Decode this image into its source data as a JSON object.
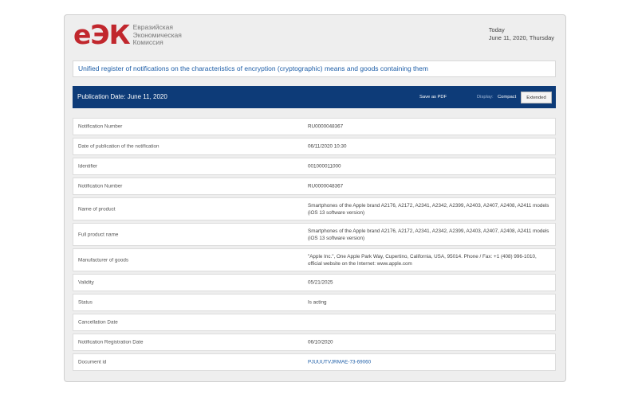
{
  "logo": {
    "mark": "еЭК",
    "line1": "Евразийская",
    "line2": "Экономическая",
    "line3": "Комиссия"
  },
  "today": {
    "label": "Today",
    "date": "June 11, 2020, Thursday"
  },
  "register_title": "Unified register of notifications on the characteristics of encryption (cryptographic) means and goods containing them",
  "publication_bar": {
    "date": "Publication Date: June 11, 2020",
    "save_pdf": "Save as PDF",
    "display_label": "Display:",
    "compact": "Compact",
    "extended": "Extended",
    "bg_color": "#0d3b78"
  },
  "rows": [
    {
      "label": "Notification Number",
      "value": "RU0000048367"
    },
    {
      "label": "Date of publication of the notification",
      "value": "06/11/2020 10:30"
    },
    {
      "label": "Identifier",
      "value": "001000011000"
    },
    {
      "label": "Notification Number",
      "value": "RU0000048367"
    },
    {
      "label": "Name of product",
      "value": "Smartphones of the Apple brand A2176, A2172, A2341, A2342, A2399, A2403, A2407, A2408, A2411 models (iOS 13 software version)"
    },
    {
      "label": "Full product name",
      "value": "Smartphones of the Apple brand A2176, A2172, A2341, A2342, A2399, A2403, A2407, A2408, A2411 models (iOS 13 software version)"
    },
    {
      "label": "Manufacturer of goods",
      "value": "\"Apple Inc.\", One Apple Park Way, Cupertino, California, USA, 95014. Phone / Fax: +1 (408) 996-1010, official website on the Internet: www.apple.com"
    },
    {
      "label": "Validity",
      "value": "05/21/2025"
    },
    {
      "label": "Status",
      "value": "Is acting"
    },
    {
      "label": "Cancellation Date",
      "value": ""
    },
    {
      "label": "Notification Registration Date",
      "value": "06/10/2020"
    },
    {
      "label": "Document id",
      "value": "PJUUUTVJRMAE-73-69060"
    }
  ]
}
